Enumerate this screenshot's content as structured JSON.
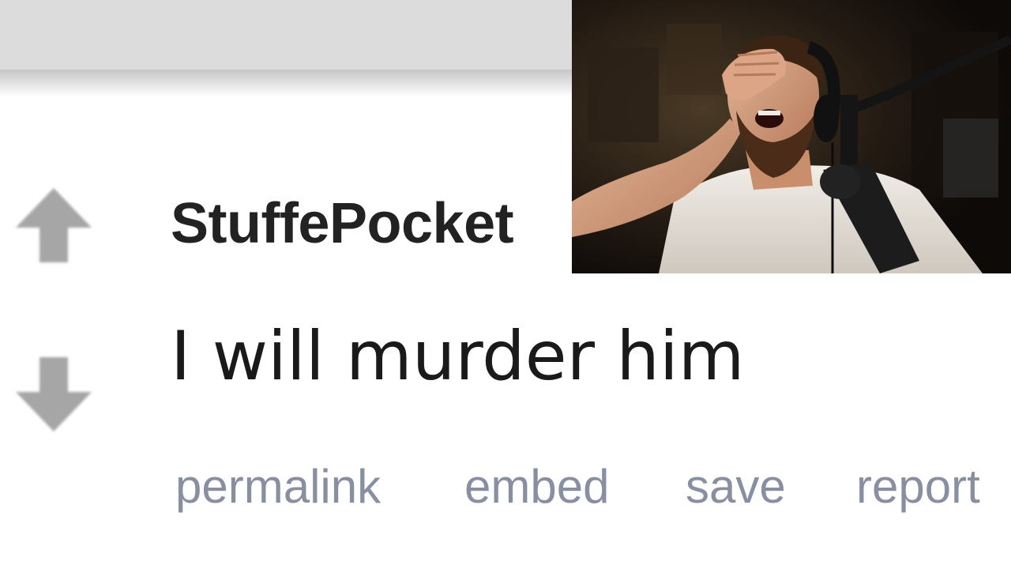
{
  "comment": {
    "username": "StuffePocket",
    "body": "I will murder him",
    "actions": {
      "permalink": "permalink",
      "embed": "embed",
      "save": "save",
      "report": "report"
    }
  },
  "icons": {
    "upvote": "upvote-arrow-icon",
    "downvote": "downvote-arrow-icon"
  },
  "colors": {
    "top_bar": "#dcdcdc",
    "arrow": "#a6a6a6",
    "username": "#222222",
    "body_text": "#1a1a1a",
    "action_links": "#888fa0"
  },
  "webcam_overlay": {
    "content": "streamer facepalm laughing"
  }
}
